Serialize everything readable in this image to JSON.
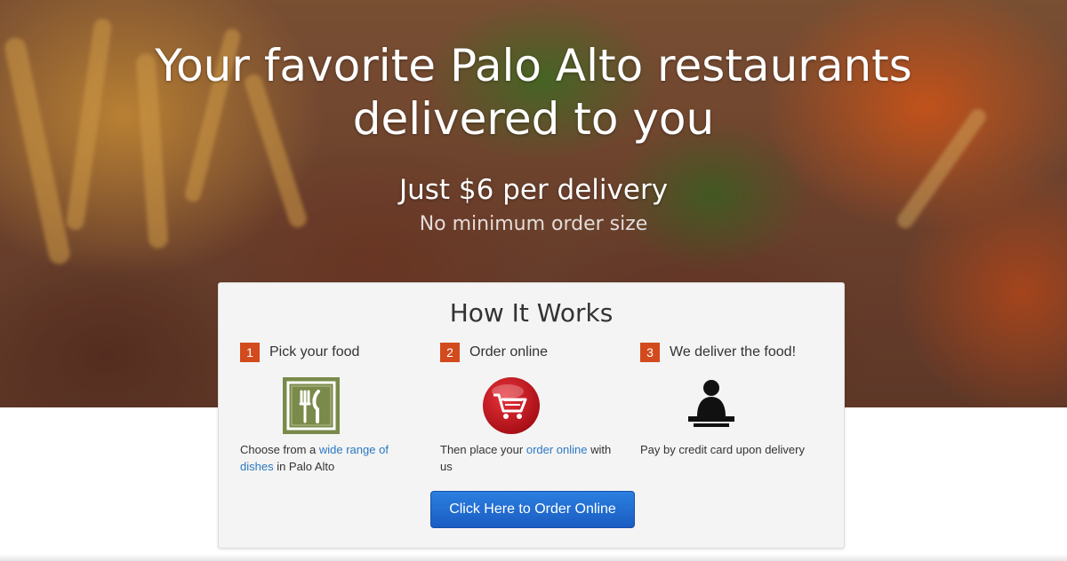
{
  "hero": {
    "headline_line1": "Your favorite Palo Alto restaurants",
    "headline_line2": "delivered to you",
    "price": "Just $6 per delivery",
    "min_order": "No minimum order size"
  },
  "how_it_works": {
    "title": "How It Works",
    "steps": [
      {
        "number": "1",
        "title": "Pick your food",
        "icon": "fork-knife-icon",
        "desc_before": "Choose from a ",
        "link": "wide range of dishes",
        "desc_after": " in Palo Alto"
      },
      {
        "number": "2",
        "title": "Order online",
        "icon": "shopping-cart-icon",
        "desc_before": "Then place your ",
        "link": "order online",
        "desc_after": " with us"
      },
      {
        "number": "3",
        "title": "We deliver the food!",
        "icon": "delivery-person-icon",
        "desc": "Pay by credit card upon delivery"
      }
    ],
    "button_label": "Click Here to Order Online"
  },
  "colors": {
    "step_badge": "#d24a1e",
    "link": "#2a78c2",
    "button": "#1a5cc2",
    "cart_red": "#c8141e",
    "menu_green": "#7a8a4a"
  }
}
